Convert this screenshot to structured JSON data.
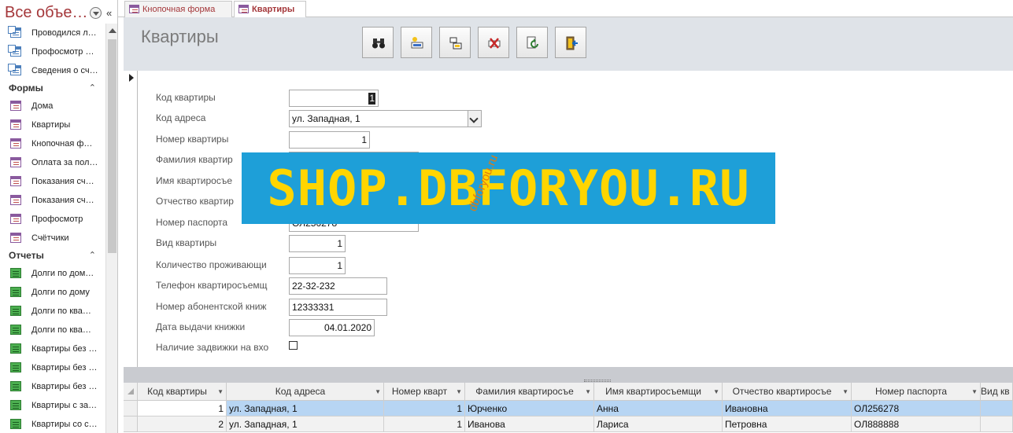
{
  "nav": {
    "title": "Все объе…",
    "items_top": [
      {
        "label": "Проводился л…",
        "icon": "query-icon"
      },
      {
        "label": "Профосмотр …",
        "icon": "query-icon"
      },
      {
        "label": "Сведения о сч…",
        "icon": "query-icon"
      }
    ],
    "forms_group": "Формы",
    "forms": [
      {
        "label": "Дома",
        "icon": "form-icon"
      },
      {
        "label": "Квартиры",
        "icon": "form-icon"
      },
      {
        "label": "Кнопочная ф…",
        "icon": "form-icon"
      },
      {
        "label": "Оплата за пол…",
        "icon": "form-icon"
      },
      {
        "label": "Показания сч…",
        "icon": "form-icon"
      },
      {
        "label": "Показания сч…",
        "icon": "form-icon"
      },
      {
        "label": "Профосмотр",
        "icon": "form-icon"
      },
      {
        "label": "Счётчики",
        "icon": "form-icon"
      }
    ],
    "reports_group": "Отчеты",
    "reports": [
      {
        "label": "Долги по дом…",
        "icon": "report-icon"
      },
      {
        "label": "Долги по дому",
        "icon": "report-icon"
      },
      {
        "label": "Долги по ква…",
        "icon": "report-icon"
      },
      {
        "label": "Долги по ква…",
        "icon": "report-icon"
      },
      {
        "label": "Квартиры без …",
        "icon": "report-icon"
      },
      {
        "label": "Квартиры без …",
        "icon": "report-icon"
      },
      {
        "label": "Квартиры без …",
        "icon": "report-icon"
      },
      {
        "label": "Квартиры с за…",
        "icon": "report-icon"
      },
      {
        "label": "Квартиры со с…",
        "icon": "report-icon"
      }
    ]
  },
  "tabs": [
    {
      "label": "Кнопочная форма",
      "active": false
    },
    {
      "label": "Квартиры",
      "active": true
    }
  ],
  "form": {
    "title": "Квартиры",
    "toolbar_icons": [
      "binoculars-icon",
      "new-record-icon",
      "save-record-icon",
      "delete-record-icon",
      "refresh-icon",
      "exit-icon"
    ],
    "fields": [
      {
        "label": "Код квартиры",
        "value": "1"
      },
      {
        "label": "Код адреса",
        "value": "ул. Западная, 1"
      },
      {
        "label": "Номер квартиры",
        "value": "1"
      },
      {
        "label": "Фамилия квартир",
        "value": ""
      },
      {
        "label": "Имя квартиросъе",
        "value": ""
      },
      {
        "label": "Отчество квартир",
        "value": ""
      },
      {
        "label": "Номер паспорта",
        "value": "ОЛ256278"
      },
      {
        "label": "Вид квартиры",
        "value": "1"
      },
      {
        "label": "Количество проживающи",
        "value": "1"
      },
      {
        "label": "Телефон квартиросъемщ",
        "value": "22-32-232"
      },
      {
        "label": "Номер абонентской книж",
        "value": "12333331"
      },
      {
        "label": "Дата выдачи книжки",
        "value": "04.01.2020"
      },
      {
        "label": "Наличие задвижки на вхо",
        "value": ""
      }
    ]
  },
  "grid": {
    "columns": [
      "Код квартиры",
      "Код адреса",
      "Номер кварт",
      "Фамилия квартиросъе",
      "Имя квартиросъемщи",
      "Отчество квартиросъе",
      "Номер паспорта",
      "Вид кв"
    ],
    "rows": [
      [
        "1",
        "ул. Западная, 1",
        "1",
        "Юрченко",
        "Анна",
        "Ивановна",
        "ОЛ256278",
        ""
      ],
      [
        "2",
        "ул. Западная, 1",
        "1",
        "Иванова",
        "Лариса",
        "Петровна",
        "ОЛ888888",
        ""
      ]
    ]
  },
  "watermark": {
    "text": "SHOP.DBFORYOU.RU",
    "small_text": "dbforyou.ru",
    "bg_color": "#1e9fd8",
    "text_color": "#ffd500"
  },
  "colors": {
    "accent": "#a4373a",
    "header_bg": "#dfe3e8",
    "selected_row": "#b7d5f3"
  }
}
